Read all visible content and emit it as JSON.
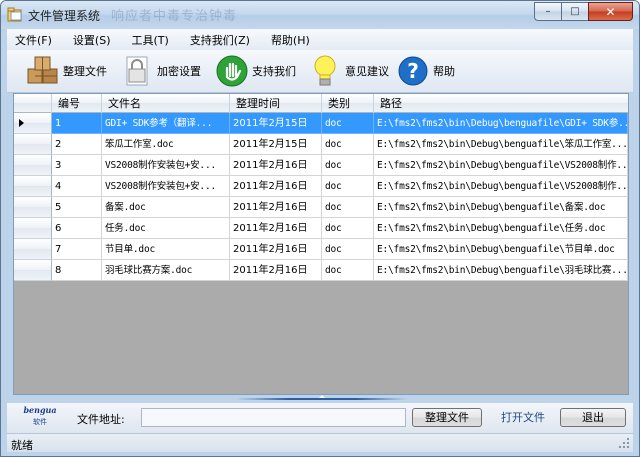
{
  "window": {
    "title": "文件管理系统",
    "title_ghost": "响应者中毒专治钟毒",
    "controls": {
      "minimize": "–",
      "maximize": "□",
      "close": "✕"
    }
  },
  "menu": [
    "文件(F)",
    "设置(S)",
    "工具(T)",
    "支持我们(Z)",
    "帮助(H)"
  ],
  "toolbar": [
    {
      "label": "整理文件",
      "icon": "boxes-icon"
    },
    {
      "label": "加密设置",
      "icon": "lock-icon"
    },
    {
      "label": "支持我们",
      "icon": "hand-icon"
    },
    {
      "label": "意见建议",
      "icon": "lightbulb-icon"
    },
    {
      "label": "帮助",
      "icon": "help-icon"
    }
  ],
  "table": {
    "columns": [
      "编号",
      "文件名",
      "整理时间",
      "类别",
      "路径"
    ],
    "selected_row": 0,
    "rows": [
      [
        "1",
        "GDI+ SDK参考（翻译...",
        "2011年2月15日",
        "doc",
        "E:\\fms2\\fms2\\bin\\Debug\\benguafile\\GDI+ SDK参..."
      ],
      [
        "2",
        "笨瓜工作室.doc",
        "2011年2月15日",
        "doc",
        "E:\\fms2\\fms2\\bin\\Debug\\benguafile\\笨瓜工作室..."
      ],
      [
        "3",
        "VS2008制作安装包+安...",
        "2011年2月16日",
        "doc",
        "E:\\fms2\\fms2\\bin\\Debug\\benguafile\\VS2008制作..."
      ],
      [
        "4",
        "VS2008制作安装包+安...",
        "2011年2月16日",
        "doc",
        "E:\\fms2\\fms2\\bin\\Debug\\benguafile\\VS2008制作..."
      ],
      [
        "5",
        "备案.doc",
        "2011年2月16日",
        "doc",
        "E:\\fms2\\fms2\\bin\\Debug\\benguafile\\备案.doc"
      ],
      [
        "6",
        "任务.doc",
        "2011年2月16日",
        "doc",
        "E:\\fms2\\fms2\\bin\\Debug\\benguafile\\任务.doc"
      ],
      [
        "7",
        "节目单.doc",
        "2011年2月16日",
        "doc",
        "E:\\fms2\\fms2\\bin\\Debug\\benguafile\\节目单.doc"
      ],
      [
        "8",
        "羽毛球比赛方案.doc",
        "2011年2月16日",
        "doc",
        "E:\\fms2\\fms2\\bin\\Debug\\benguafile\\羽毛球比赛..."
      ]
    ]
  },
  "bottom": {
    "logo_top": "bengua",
    "logo_bottom": "软件",
    "path_label": "文件地址:",
    "path_value": "",
    "organize_button": "整理文件",
    "open_button": "打开文件",
    "exit_button": "退出"
  },
  "status": "就绪",
  "colors": {
    "selection": "#3399ff",
    "frame": "#bcd3ea",
    "grid_empty": "#ababab"
  }
}
